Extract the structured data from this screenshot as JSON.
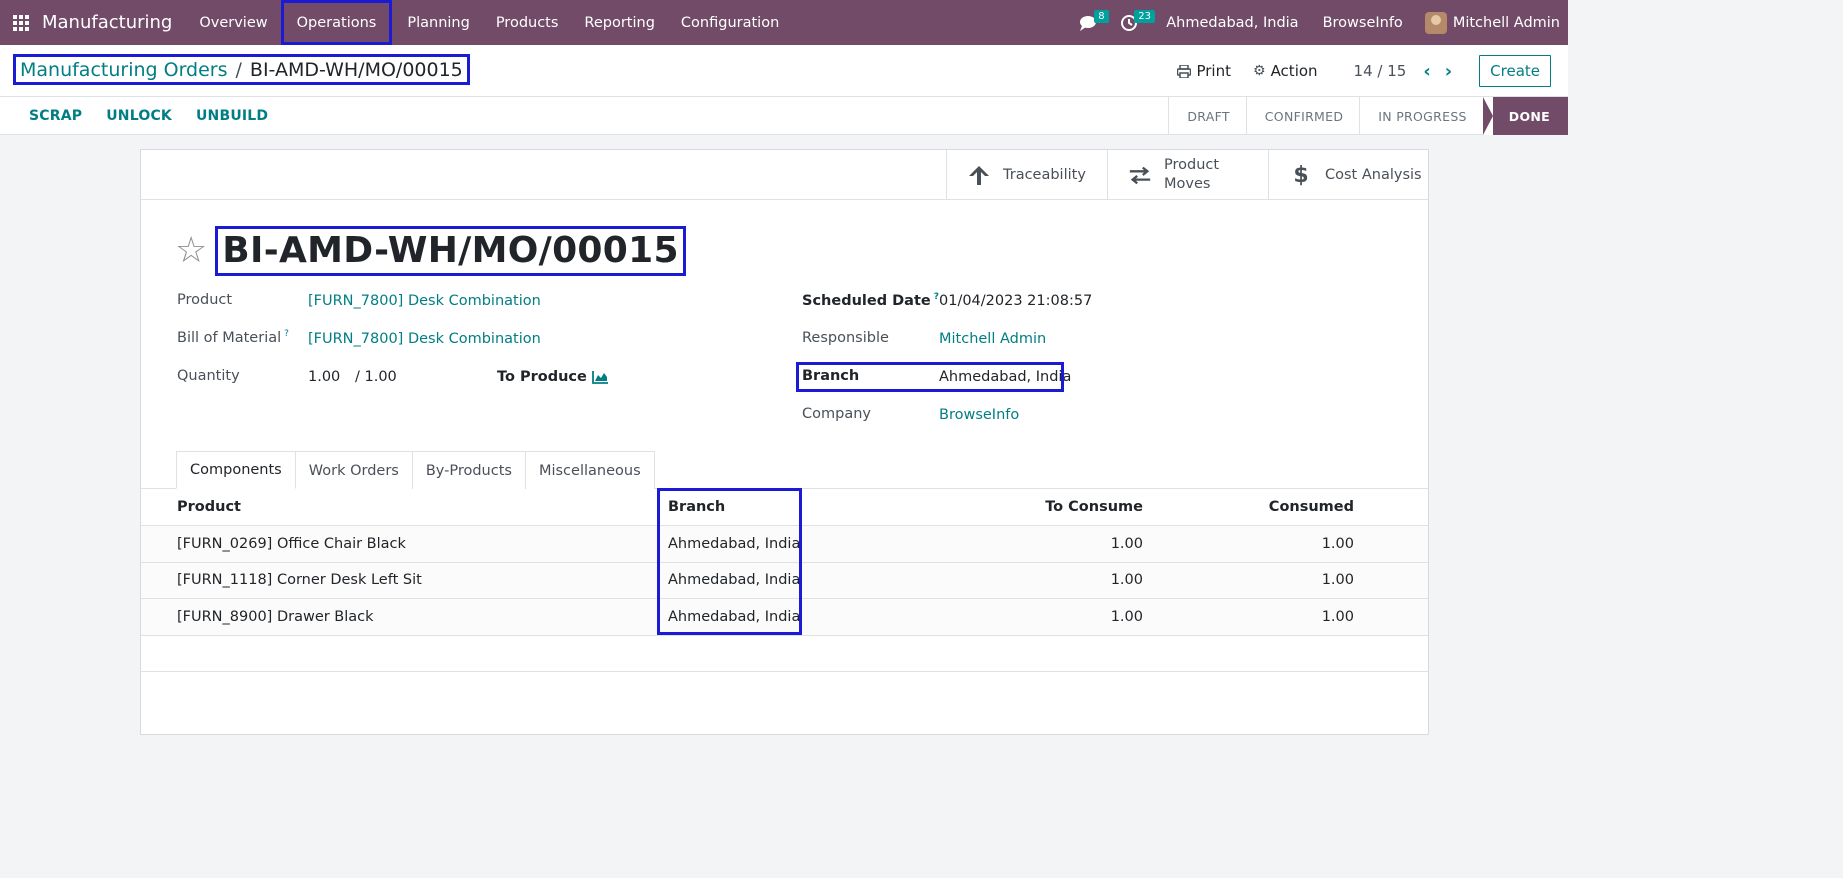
{
  "navbar": {
    "app_name": "Manufacturing",
    "menus": [
      "Overview",
      "Operations",
      "Planning",
      "Products",
      "Reporting",
      "Configuration"
    ],
    "messages_count": "8",
    "activities_count": "23",
    "branch": "Ahmedabad, India",
    "company": "BrowseInfo",
    "user": "Mitchell Admin"
  },
  "breadcrumb": {
    "parent": "Manufacturing Orders",
    "separator": "/",
    "current": "BI-AMD-WH/MO/00015"
  },
  "control": {
    "print_label": "Print",
    "action_label": "Action",
    "pager": "14 / 15",
    "create_label": "Create"
  },
  "header_buttons": [
    "SCRAP",
    "UNLOCK",
    "UNBUILD"
  ],
  "stages": [
    "DRAFT",
    "CONFIRMED",
    "IN PROGRESS",
    "DONE"
  ],
  "smart_buttons": {
    "traceability": "Traceability",
    "product_moves_1": "Product",
    "product_moves_2": "Moves",
    "cost_analysis": "Cost Analysis"
  },
  "record": {
    "name": "BI-AMD-WH/MO/00015",
    "product_label": "Product",
    "product_value": "[FURN_7800] Desk Combination",
    "bom_label": "Bill of Material",
    "bom_value": "[FURN_7800] Desk Combination",
    "quantity_label": "Quantity",
    "quantity_value": "1.00",
    "quantity_total": "/ 1.00",
    "to_produce_label": "To Produce",
    "scheduled_label": "Scheduled Date",
    "scheduled_value": "01/04/2023 21:08:57",
    "responsible_label": "Responsible",
    "responsible_value": "Mitchell Admin",
    "branch_label": "Branch",
    "branch_value": "Ahmedabad, India",
    "company_label": "Company",
    "company_value": "BrowseInfo",
    "help_mark": "?"
  },
  "tabs": [
    "Components",
    "Work Orders",
    "By-Products",
    "Miscellaneous"
  ],
  "components": {
    "headers": {
      "product": "Product",
      "branch": "Branch",
      "to_consume": "To Consume",
      "consumed": "Consumed"
    },
    "rows": [
      {
        "product": "[FURN_0269] Office Chair Black",
        "branch": "Ahmedabad, India",
        "to_consume": "1.00",
        "consumed": "1.00"
      },
      {
        "product": "[FURN_1118] Corner Desk Left Sit",
        "branch": "Ahmedabad, India",
        "to_consume": "1.00",
        "consumed": "1.00"
      },
      {
        "product": "[FURN_8900] Drawer Black",
        "branch": "Ahmedabad, India",
        "to_consume": "1.00",
        "consumed": "1.00"
      }
    ]
  },
  "colors": {
    "brand": "#714b67",
    "link": "#017e84",
    "highlight": "#1b1bd6"
  }
}
